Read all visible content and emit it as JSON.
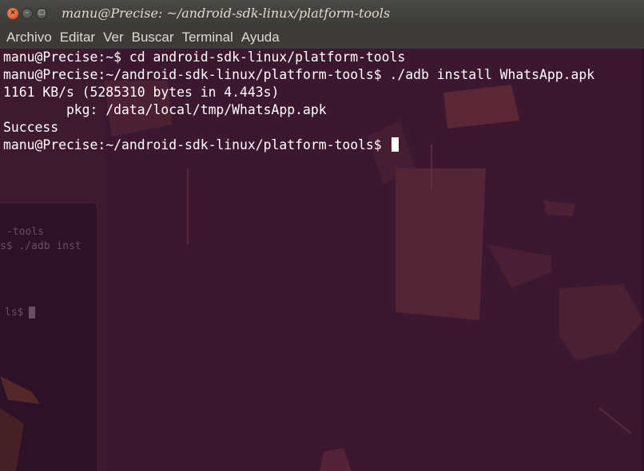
{
  "window": {
    "title": "manu@Precise: ~/android-sdk-linux/platform-tools",
    "close_symbol": "×",
    "minimize_symbol": "–",
    "maximize_symbol": "□"
  },
  "menu": [
    "Archivo",
    "Editar",
    "Ver",
    "Buscar",
    "Terminal",
    "Ayuda"
  ],
  "terminal": {
    "lines": [
      "manu@Precise:~$ cd android-sdk-linux/platform-tools",
      "manu@Precise:~/android-sdk-linux/platform-tools$ ./adb install WhatsApp.apk",
      "1161 KB/s (5285310 bytes in 4.443s)",
      "        pkg: /data/local/tmp/WhatsApp.apk",
      "Success",
      "manu@Precise:~/android-sdk-linux/platform-tools$ "
    ],
    "background_window_fragments": [
      "-tools",
      "s$ ./adb inst",
      "ls$"
    ]
  },
  "colors": {
    "terminal_bg": "#3a1730",
    "text": "#ffffff",
    "titlebar": "#3c3b37",
    "close_button": "#e05a2b"
  }
}
